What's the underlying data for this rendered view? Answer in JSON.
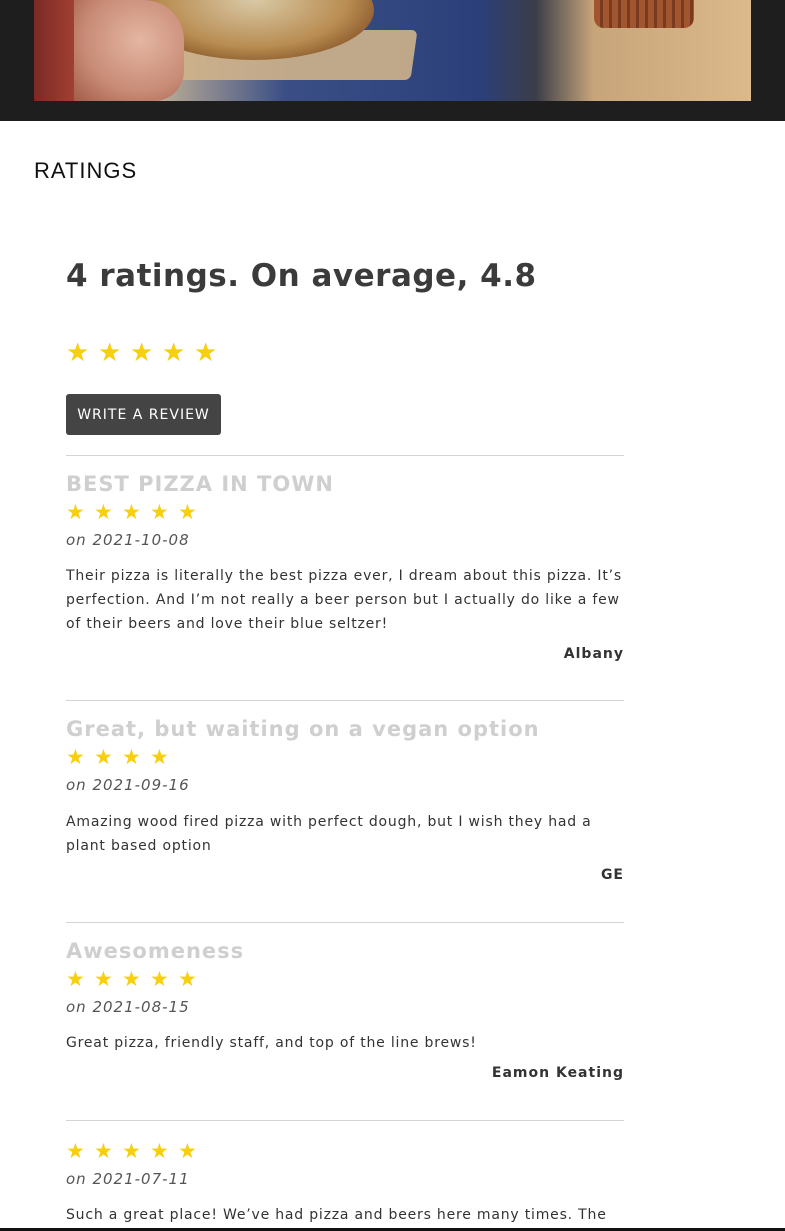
{
  "section": {
    "title": "RATINGS"
  },
  "summary": {
    "text": "4 ratings. On average, 4.8",
    "stars": 5
  },
  "write_review_button": "WRITE A REVIEW",
  "reviews": [
    {
      "title": "BEST PIZZA IN TOWN",
      "stars": 5,
      "date": "on 2021-10-08",
      "body": "Their pizza is literally the best pizza ever, I dream about this pizza. It’s perfection. And I’m not really a beer person but I actually do like a few of their beers and love their blue seltzer!",
      "author": "Albany"
    },
    {
      "title": "Great, but waiting on a vegan option",
      "stars": 4,
      "date": "on 2021-09-16",
      "body": "Amazing wood fired pizza with perfect dough, but I wish they had a plant based option",
      "author": "GE"
    },
    {
      "title": "Awesomeness",
      "stars": 5,
      "date": "on 2021-08-15",
      "body": "Great pizza, friendly staff, and top of the line brews!",
      "author": "Eamon Keating"
    },
    {
      "title": "",
      "stars": 5,
      "date": "on 2021-07-11",
      "body": "Such a great place! We’ve had pizza and beers here many times. The",
      "author": ""
    }
  ],
  "colors": {
    "star": "#f7cf0f",
    "button_bg": "#444444",
    "hero_band": "#1e1e1e",
    "review_title": "#cfcfcf"
  },
  "icons": {
    "star": "star-icon"
  }
}
